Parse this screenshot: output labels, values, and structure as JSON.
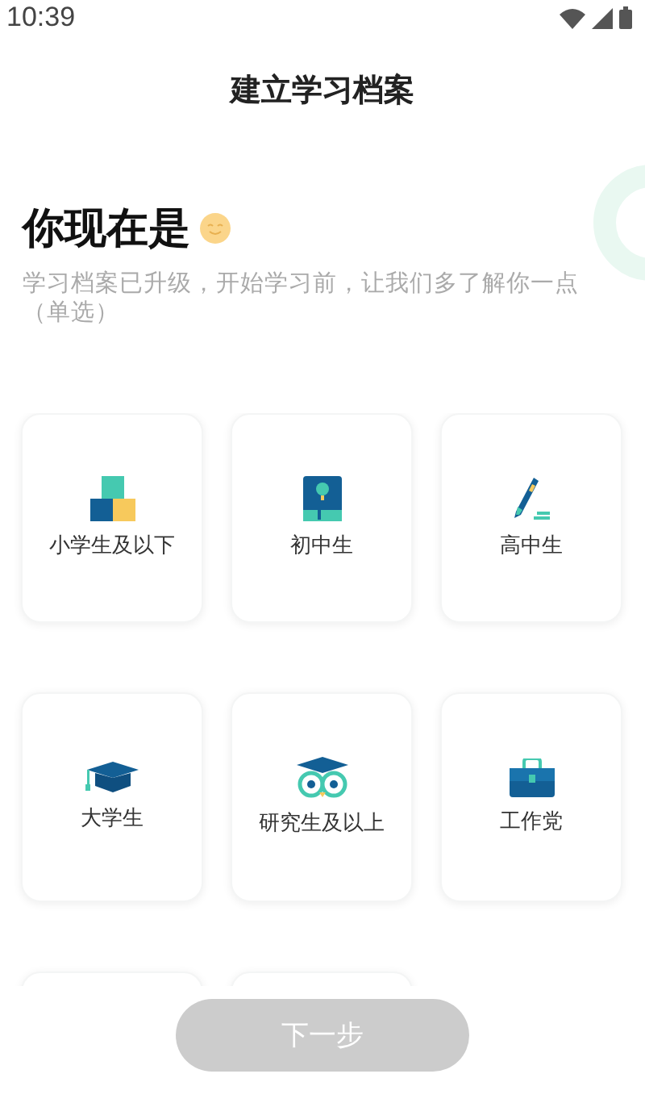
{
  "status_bar": {
    "time": "10:39"
  },
  "header": {
    "title": "建立学习档案"
  },
  "question": {
    "title": "你现在是",
    "subtitle": "学习档案已升级，开始学习前，让我们多了解你一点（单选）"
  },
  "options": [
    {
      "label": "小学生及以下",
      "selected": false
    },
    {
      "label": "初中生",
      "selected": false
    },
    {
      "label": "高中生",
      "selected": false
    },
    {
      "label": "大学生",
      "selected": false
    },
    {
      "label": "研究生及以上",
      "selected": false
    },
    {
      "label": "工作党",
      "selected": false
    },
    {
      "selected": false
    },
    {
      "selected": false
    }
  ],
  "next_button": {
    "label": "下一步",
    "disabled": true
  }
}
